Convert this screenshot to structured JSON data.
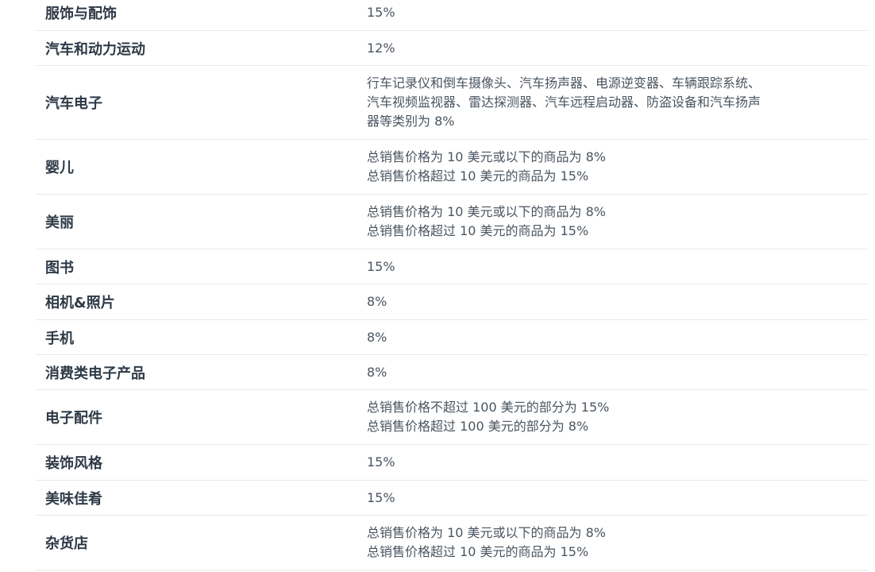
{
  "table": {
    "rows": [
      {
        "category": "服饰与配饰",
        "rate": "15%"
      },
      {
        "category": "汽车和动力运动",
        "rate": "12%"
      },
      {
        "category": "汽车电子",
        "rate": "行车记录仪和倒车摄像头、汽车扬声器、电源逆变器、车辆跟踪系统、\n汽车视频监视器、雷达探测器、汽车远程启动器、防盗设备和汽车扬声\n器等类别为 8%"
      },
      {
        "category": "婴儿",
        "rate": "总销售价格为 10 美元或以下的商品为 8%\n总销售价格超过 10 美元的商品为 15%"
      },
      {
        "category": "美丽",
        "rate": "总销售价格为 10 美元或以下的商品为 8%\n总销售价格超过 10 美元的商品为 15%"
      },
      {
        "category": "图书",
        "rate": "15%"
      },
      {
        "category": "相机&照片",
        "rate": "8%"
      },
      {
        "category": "手机",
        "rate": "8%"
      },
      {
        "category": "消费类电子产品",
        "rate": "8%"
      },
      {
        "category": "电子配件",
        "rate": "总销售价格不超过 100 美元的部分为 15%\n总销售价格超过 100 美元的部分为 8%"
      },
      {
        "category": "装饰风格",
        "rate": "15%"
      },
      {
        "category": "美味佳肴",
        "rate": "15%"
      },
      {
        "category": "杂货店",
        "rate": "总销售价格为 10 美元或以下的商品为 8%\n总销售价格超过 10 美元的商品为 15%"
      }
    ]
  }
}
